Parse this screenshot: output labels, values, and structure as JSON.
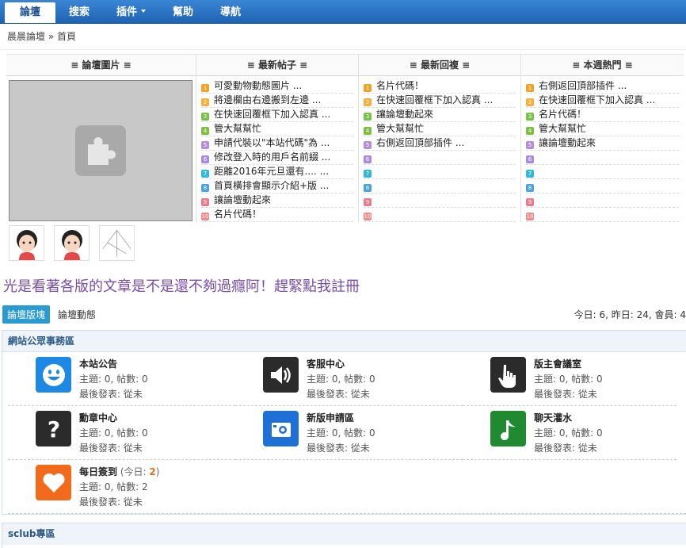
{
  "nav": {
    "tabs": [
      "論壇",
      "搜索",
      "插件",
      "幫助",
      "導航"
    ]
  },
  "breadcrumb": {
    "home": "晨晨論壇",
    "sep": "»",
    "current": "首頁"
  },
  "grid": {
    "col1": {
      "title": "≡ 論壇圖片 ≡"
    },
    "col2": {
      "title": "≡ 最新帖子 ≡",
      "items": [
        "可愛動物動態圖片 ...",
        "將邊欄由右邊搬到左邊 ...",
        "在快速回覆框下加入認真 ...",
        "管大幫幫忙",
        "申請代裝以\"本站代碼\"為 ...",
        "修改登入時的用戶名前綴 ...",
        "距離2016年元旦還有.... ...",
        "首頁橫排會顯示介紹+版 ...",
        "讓論壇動起來",
        "名片代碼！"
      ]
    },
    "col3": {
      "title": "≡ 最新回複 ≡",
      "items": [
        "名片代碼！",
        "在快速回覆框下加入認真 ...",
        "讓論壇動起來",
        "管大幫幫忙",
        "右側返回頂部插件 ...",
        "",
        "",
        "",
        "",
        ""
      ]
    },
    "col4": {
      "title": "≡ 本週熱門 ≡",
      "items": [
        "右側返回頂部插件 ...",
        "在快速回覆框下加入認真 ...",
        "名片代碼！",
        "管大幫幫忙",
        "讓論壇動起來",
        "",
        "",
        "",
        "",
        ""
      ]
    }
  },
  "promo": "光是看著各版的文章是不是還不夠過癮阿！趕緊點我註冊",
  "bar": {
    "tab1": "論壇版塊",
    "tab2": "論壇動態",
    "stats": "今日: 6, 昨日: 24, 會員: 4"
  },
  "section1": {
    "title": "網站公眾事務區",
    "forums": [
      {
        "name": "本站公告",
        "topics": "主題: 0, 帖數: 0",
        "last": "最後發表: 從未",
        "color": "#1e88e5",
        "icon": "smiley-icon"
      },
      {
        "name": "客服中心",
        "topics": "主題: 0, 帖數: 0",
        "last": "最後發表: 從未",
        "color": "#2b2b2b",
        "icon": "speaker-icon"
      },
      {
        "name": "版主會議室",
        "topics": "主題: 0, 帖數: 0",
        "last": "最後發表: 從未",
        "color": "#2b2b2b",
        "icon": "hand-icon"
      },
      {
        "name": "勳章中心",
        "topics": "主題: 0, 帖數: 0",
        "last": "最後發表: 從未",
        "color": "#2b2b2b",
        "icon": "question-icon"
      },
      {
        "name": "新版申請區",
        "topics": "主題: 0, 帖數: 0",
        "last": "最後發表: 從未",
        "color": "#1e6fd6",
        "icon": "camera-icon"
      },
      {
        "name": "聊天灌水",
        "topics": "主題: 0, 帖數: 0",
        "last": "最後發表: 從未",
        "color": "#1f8a2f",
        "icon": "music-icon"
      },
      {
        "name": "每日簽到",
        "today_prefix": "(今日: ",
        "today_num": "2",
        "today_suffix": ")",
        "topics": "主題: 0, 帖數: 2",
        "last": "最後發表: 從未",
        "color": "#f26b1d",
        "icon": "heart-icon"
      }
    ]
  },
  "section2": {
    "title": "sclub專區"
  }
}
